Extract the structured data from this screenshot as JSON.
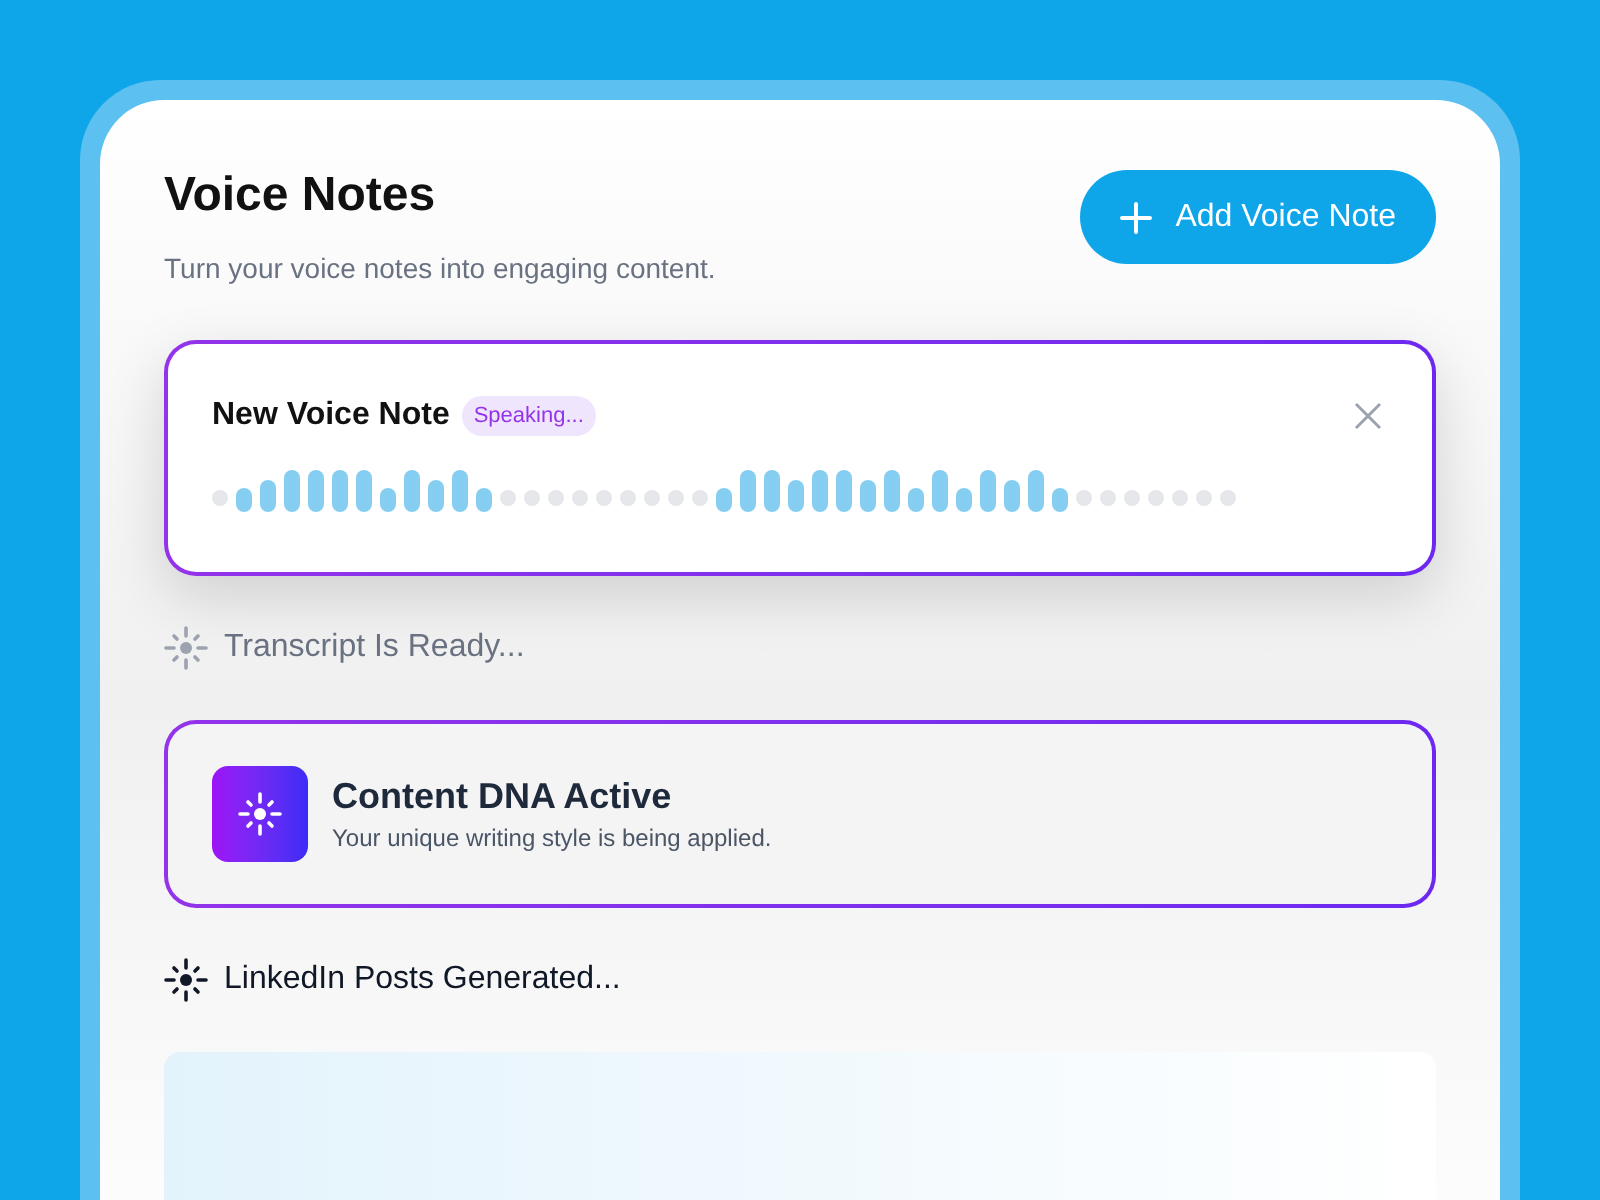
{
  "header": {
    "title": "Voice Notes",
    "subtitle": "Turn your voice notes into engaging content."
  },
  "add_button": {
    "label": "Add Voice Note"
  },
  "voice_note": {
    "title": "New Voice Note",
    "badge": "Speaking..."
  },
  "steps": [
    {
      "kind": "status",
      "label": "Transcript Is Ready...",
      "dimmed": true
    },
    {
      "kind": "card",
      "title": "Content DNA Active",
      "description": "Your unique writing style is being applied."
    },
    {
      "kind": "status",
      "label": "LinkedIn Posts Generated...",
      "dimmed": false
    }
  ]
}
